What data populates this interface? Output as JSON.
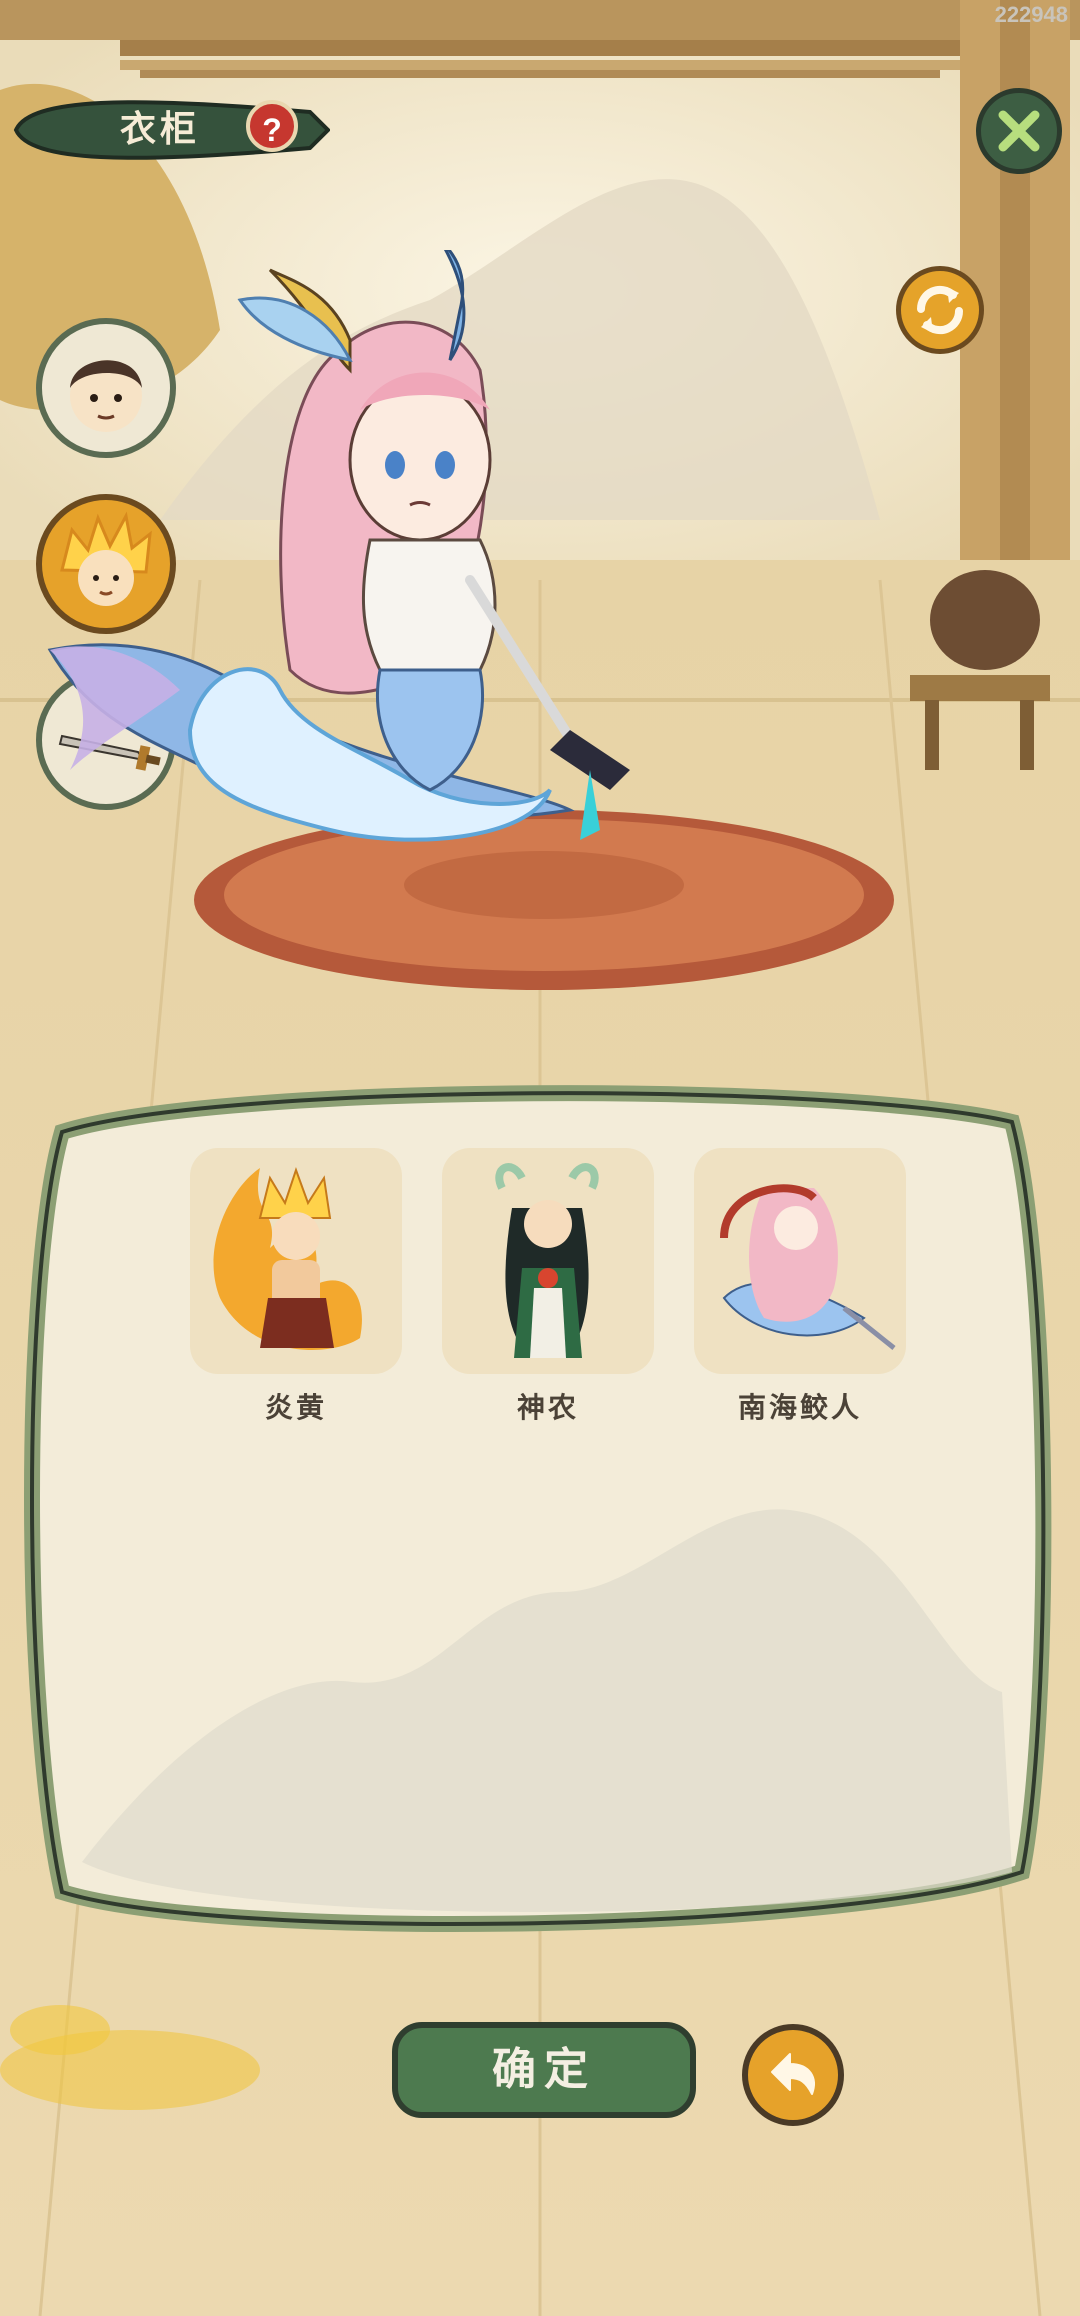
{
  "header": {
    "title": "衣柜",
    "help_symbol": "?",
    "corner_id": "222948"
  },
  "side_tabs": [
    {
      "name": "head-tab",
      "icon": "boy-face-icon"
    },
    {
      "name": "hair-tab",
      "icon": "golden-hair-face-icon"
    },
    {
      "name": "weapon-tab",
      "icon": "sword-icon"
    }
  ],
  "characters": [
    {
      "name": "炎黄"
    },
    {
      "name": "神农"
    },
    {
      "name": "南海鲛人"
    }
  ],
  "footer": {
    "confirm_label": "确定"
  },
  "colors": {
    "accent_green": "#4d7a4f",
    "accent_orange": "#e6a22a",
    "panel_bg": "#f3ecd9",
    "panel_border": "#8c9f74"
  }
}
